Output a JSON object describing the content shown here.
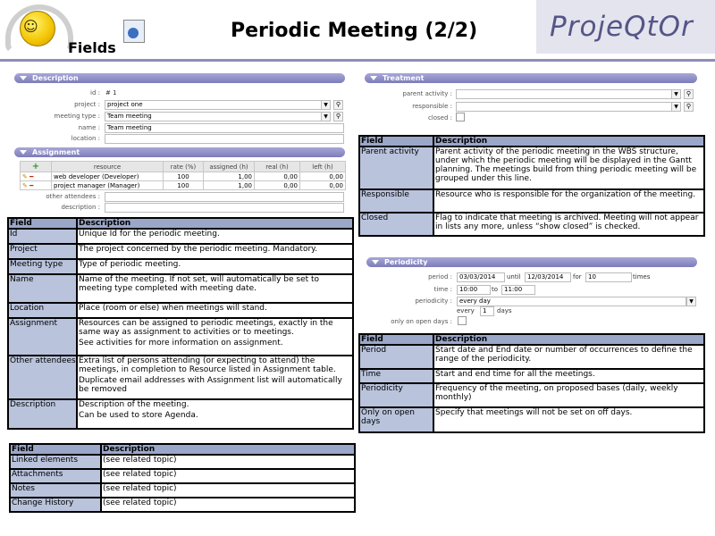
{
  "header": {
    "fields_label": "Fields",
    "title": "Periodic Meeting (2/2)",
    "brand": "ProjeQtOr"
  },
  "description_section": {
    "title": "Description",
    "id_label": "id :",
    "id_value": "# 1",
    "project_label": "project :",
    "project_value": "project one",
    "meeting_type_label": "meeting type :",
    "meeting_type_value": "Team meeting",
    "name_label": "name :",
    "name_value": "Team meeting",
    "location_label": "location :",
    "location_value": ""
  },
  "assignment_section": {
    "title": "Assignment",
    "columns": [
      "resource",
      "rate (%)",
      "assigned (h)",
      "real (h)",
      "left (h)"
    ],
    "rows": [
      {
        "resource": "web developer (Developer)",
        "rate": "100",
        "assigned": "1,00",
        "real": "0,00",
        "left": "0,00"
      },
      {
        "resource": "project manager (Manager)",
        "rate": "100",
        "assigned": "1,00",
        "real": "0,00",
        "left": "0,00"
      }
    ],
    "other_attendees_label": "other attendees :",
    "description_label": "description :"
  },
  "treatment_section": {
    "title": "Treatment",
    "parent_activity_label": "parent activity :",
    "responsible_label": "responsible :",
    "closed_label": "closed :"
  },
  "periodicity_section": {
    "title": "Periodicity",
    "period_label": "period :",
    "period_start": "03/03/2014",
    "until_label": "until",
    "period_end": "12/03/2014",
    "for_label": "for",
    "for_value": "10",
    "times_label": "times",
    "time_label": "time :",
    "time_start": "10:00",
    "to_label": "to",
    "time_end": "11:00",
    "periodicity_label": "periodicity :",
    "periodicity_value": "every day",
    "every_label": "every",
    "every_value": "1",
    "days_label": "days",
    "only_open_days_label": "only on open days :"
  },
  "table_main": {
    "head": [
      "Field",
      "Description"
    ],
    "rows": [
      {
        "field": "Id",
        "desc": [
          "Unique Id for the periodic meeting."
        ]
      },
      {
        "field": "Project",
        "desc": [
          "The project concerned by the periodic meeting. Mandatory."
        ]
      },
      {
        "field": "Meeting type",
        "desc": [
          "Type of periodic meeting."
        ]
      },
      {
        "field": "Name",
        "desc": [
          "Name of the meeting. If not set, will automatically be set to meeting type completed with meeting date."
        ]
      },
      {
        "field": "Location",
        "desc": [
          "Place (room or else) when meetings will stand."
        ]
      },
      {
        "field": "Assignment",
        "desc": [
          "Resources can be assigned to periodic meetings, exactly in the same way as assignment to activities or to meetings.",
          "See activities for more information on assignment."
        ]
      },
      {
        "field": "Other attendees",
        "desc": [
          "Extra list of persons attending (or expecting to attend) the meetings, in completion to Resource listed in Assignment table.",
          "Duplicate email addresses with Assignment list will automatically be removed"
        ]
      },
      {
        "field": "Description",
        "desc": [
          "Description of the meeting.",
          "Can be used to store Agenda."
        ]
      }
    ]
  },
  "table_bottom": {
    "head": [
      "Field",
      "Description"
    ],
    "rows": [
      {
        "field": "Linked elements",
        "desc": "(see related topic)"
      },
      {
        "field": "Attachments",
        "desc": "(see related topic)"
      },
      {
        "field": "Notes",
        "desc": "(see related topic)"
      },
      {
        "field": "Change History",
        "desc": "(see related topic)"
      }
    ]
  },
  "table_treatment": {
    "head": [
      "Field",
      "Description"
    ],
    "rows": [
      {
        "field": "Parent activity",
        "desc": "Parent activity of the periodic meeting in the WBS structure, under which the periodic meeting will be displayed in the Gantt planning. The meetings build from thing periodic meeting will be grouped under this line."
      },
      {
        "field": "Responsible",
        "desc": "Resource who is responsible for the organization of the meeting."
      },
      {
        "field": "Closed",
        "desc": "Flag to indicate that meeting is archived. Meeting will not appear in lists any more, unless “show closed” is checked."
      }
    ]
  },
  "table_periodicity": {
    "head": [
      "Field",
      "Description"
    ],
    "rows": [
      {
        "field": "Period",
        "desc": "Start date and End date or number of occurrences to define the range of the periodicity."
      },
      {
        "field": "Time",
        "desc": "Start and end time for all the meetings."
      },
      {
        "field": "Periodicity",
        "desc": "Frequency of the meeting, on proposed bases (daily, weekly monthly)"
      },
      {
        "field": "Only on open days",
        "desc": "Specify that meetings will not be set on off days."
      }
    ]
  }
}
